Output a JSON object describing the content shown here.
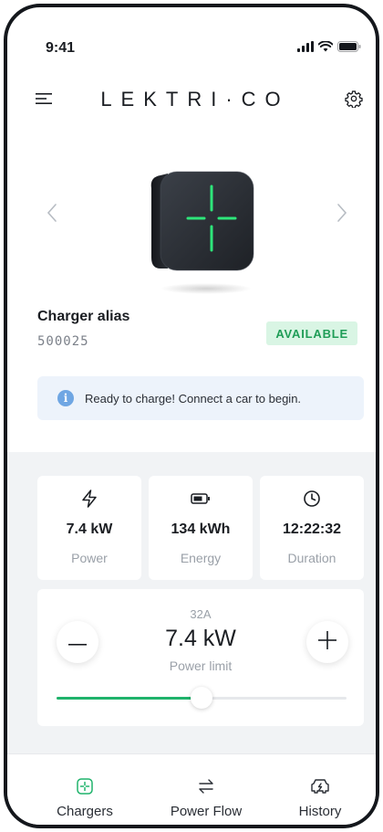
{
  "status_bar": {
    "time": "9:41",
    "icons": [
      "signal-icon",
      "wifi-icon",
      "battery-icon"
    ]
  },
  "header": {
    "logo": "LEKTRI·CO",
    "icons": [
      "menu-icon",
      "gear-icon"
    ]
  },
  "charger": {
    "alias": "Charger alias",
    "id": "500025",
    "status": "AVAILABLE",
    "status_color": "#1f9d57",
    "status_bg": "#d9f5e4",
    "led_color": "#2ee67a"
  },
  "info_banner": {
    "icon": "info-icon",
    "text": "Ready to charge! Connect a car to begin."
  },
  "stats": [
    {
      "icon": "bolt-icon",
      "value": "7.4 kW",
      "label": "Power"
    },
    {
      "icon": "battery-icon",
      "value": "134 kWh",
      "label": "Energy"
    },
    {
      "icon": "clock-icon",
      "value": "12:22:32",
      "label": "Duration"
    }
  ],
  "power_limit": {
    "amps": "32A",
    "value": "7.4 kW",
    "label": "Power limit",
    "slider_fraction": 0.5,
    "accent": "#1fb36b"
  },
  "bottom_nav": [
    {
      "icon": "charger-icon",
      "label": "Chargers",
      "active": true
    },
    {
      "icon": "power-flow-icon",
      "label": "Power Flow",
      "active": false
    },
    {
      "icon": "history-icon",
      "label": "History",
      "active": false
    }
  ]
}
